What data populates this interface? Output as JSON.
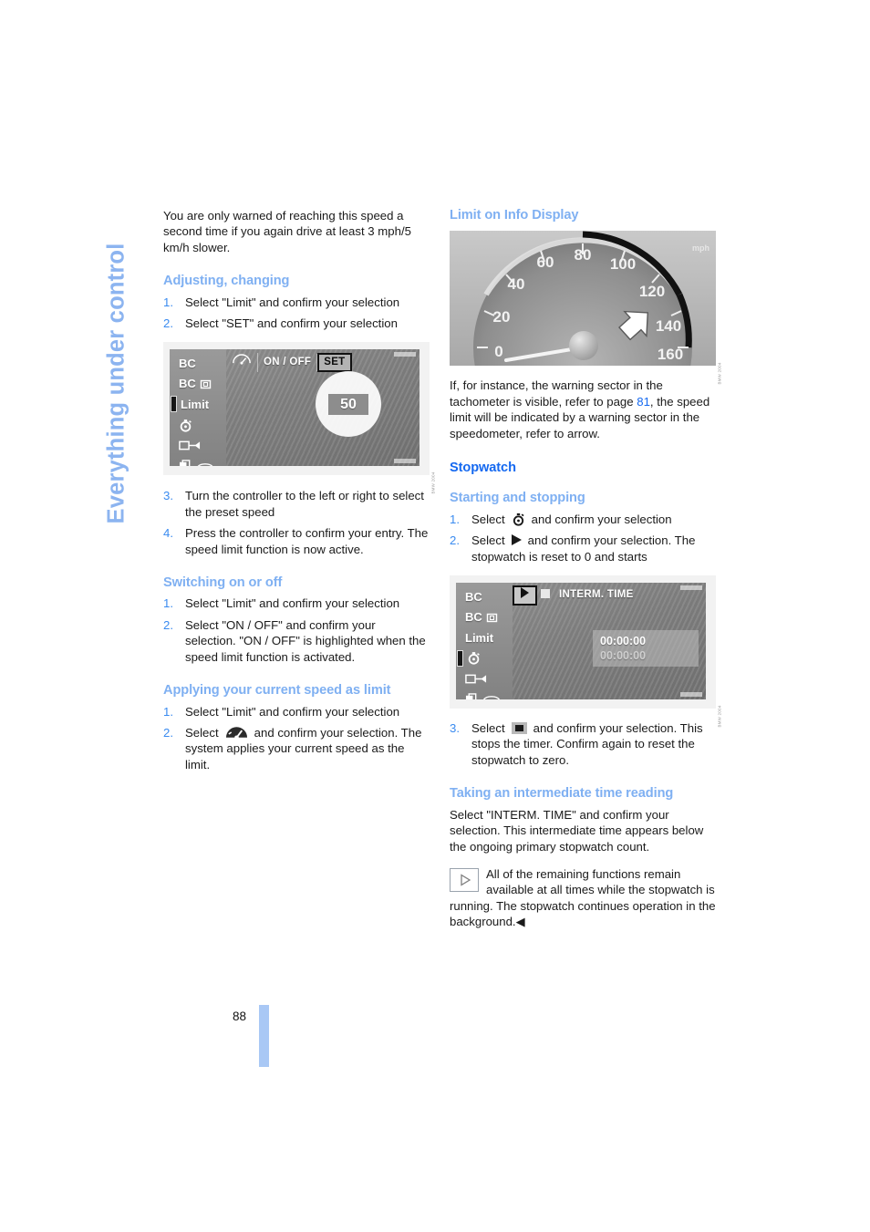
{
  "chapter_tab": {
    "label": "Everything under control"
  },
  "page": {
    "number": "88"
  },
  "colors": {
    "heading_primary": "#1569f0",
    "heading_secondary": "#7fb0f2",
    "list_number": "#3a8bf0",
    "page_ref_link": "#1569f0",
    "chapter_tab": "#8cb4f0",
    "page_bar": "#a9c8f5"
  },
  "left_column": {
    "intro_paragraph": "You are only warned of reaching this speed a second time if you again drive at least 3 mph/5 km/h slower.",
    "section_adjusting": {
      "heading": "Adjusting, changing",
      "steps": [
        {
          "num": "1.",
          "text": "Select \"Limit\" and confirm your selection"
        },
        {
          "num": "2.",
          "text": "Select \"SET\" and confirm your selection"
        }
      ]
    },
    "figure_limit_set": {
      "sidebar_items": [
        "BC",
        "BC",
        "Limit",
        "",
        "",
        ""
      ],
      "sidebar_item_2_suffix": "icon-briefcase",
      "selected_sidebar_item": "Limit",
      "topbar_items": [
        "gauge-icon",
        "ON / OFF",
        "SET"
      ],
      "topbar_selected": "SET",
      "speed_value": "50",
      "caption": "BMW 2004"
    },
    "steps_continued": [
      {
        "num": "3.",
        "text": "Turn the controller to the left or right to select the preset speed"
      },
      {
        "num": "4.",
        "text": "Press the controller to confirm your entry. The speed limit function is now active."
      }
    ],
    "section_switching": {
      "heading": "Switching on or off",
      "steps": [
        {
          "num": "1.",
          "text": "Select \"Limit\" and confirm your selection"
        },
        {
          "num": "2.",
          "text": "Select \"ON / OFF\" and confirm your selection. \"ON / OFF\" is highlighted when the speed limit function is activated."
        }
      ]
    },
    "section_applying": {
      "heading": "Applying your current speed as limit",
      "step1": {
        "num": "1.",
        "text": "Select \"Limit\" and confirm your selection"
      },
      "step2": {
        "num": "2.",
        "text_before": "Select",
        "icon": "gauge-icon",
        "text_after": "and confirm your selection. The system applies your current speed as the limit."
      }
    }
  },
  "right_column": {
    "section_limit_info": {
      "heading": "Limit on Info Display",
      "figure": {
        "tick_labels": [
          "0",
          "20",
          "40",
          "60",
          "80",
          "100",
          "120",
          "140",
          "160"
        ],
        "unit": "mph",
        "needle_value": "0",
        "warning_sector_start": "80",
        "warning_sector_end": "160",
        "arrow": "pointer-arrow",
        "caption": "BMW 2004"
      },
      "paragraph_before_ref": "If, for instance, the warning sector in the tachometer is visible, refer to page",
      "page_ref": "81",
      "paragraph_after_ref": ", the speed limit will be indicated by a warning sector in the speedometer, refer to arrow."
    },
    "section_stopwatch": {
      "heading": "Stopwatch",
      "subsection_starting": {
        "heading": "Starting and stopping",
        "step1": {
          "num": "1.",
          "text_before": "Select",
          "icon": "stopwatch-icon",
          "text_after": "and confirm your selection"
        },
        "step2": {
          "num": "2.",
          "text_before": "Select",
          "icon": "play-icon",
          "text_after": "and confirm your selection. The stopwatch is reset to 0 and starts"
        },
        "figure": {
          "sidebar_items": [
            "BC",
            "BC",
            "Limit",
            "",
            "",
            ""
          ],
          "selected_sidebar_item": "stopwatch-icon",
          "topbar_items": [
            "play-icon",
            "stop-icon",
            "INTERM. TIME"
          ],
          "topbar_selected": "play-icon",
          "primary_time": "00:00:00",
          "intermediate_time": "00:00:00",
          "caption": "BMW 2004"
        },
        "step3": {
          "num": "3.",
          "text_before": "Select",
          "icon": "stop-icon",
          "text_after": "and confirm your selection. This stops the timer. Confirm again to reset the stopwatch to zero."
        }
      },
      "subsection_intermediate": {
        "heading": "Taking an intermediate time reading",
        "paragraph": "Select \"INTERM. TIME\" and confirm your selection. This intermediate time appears below the ongoing primary stopwatch count.",
        "note": "All of the remaining functions remain available at all times while the stopwatch is running. The stopwatch continues operation in the background.◀"
      }
    }
  }
}
